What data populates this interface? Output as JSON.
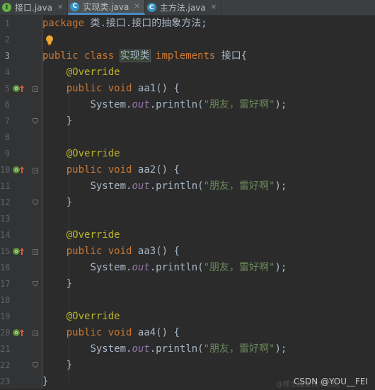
{
  "tabs": [
    {
      "label": "接口.java",
      "icon": "interface-icon",
      "active": false
    },
    {
      "label": "实现类.java",
      "icon": "class-icon",
      "active": true
    },
    {
      "label": "主方法.java",
      "icon": "class-icon",
      "active": false
    }
  ],
  "code": {
    "package_kw": "package",
    "package_name": "类.接口.接口的抽象方法;",
    "public_kw": "public",
    "class_kw": "class",
    "class_name": "实现类",
    "implements_kw": "implements",
    "interface_name": "接口{",
    "override": "@Override",
    "void_kw": "void",
    "methods": [
      "aa1",
      "aa2",
      "aa3",
      "aa4"
    ],
    "paren_open": "() {",
    "system": "System.",
    "out": "out",
    "println_open": ".println(",
    "string": "\"朋友，雷好啊\"",
    "println_close": ");",
    "close_brace": "}"
  },
  "line_numbers": [
    "1",
    "2",
    "3",
    "4",
    "5",
    "6",
    "7",
    "8",
    "9",
    "10",
    "11",
    "12",
    "13",
    "14",
    "15",
    "16",
    "17",
    "18",
    "19",
    "20",
    "21",
    "22",
    "23"
  ],
  "watermark": "CSDN @YOU__FEI",
  "watermark_faint": "@稀土掘金技术社区"
}
